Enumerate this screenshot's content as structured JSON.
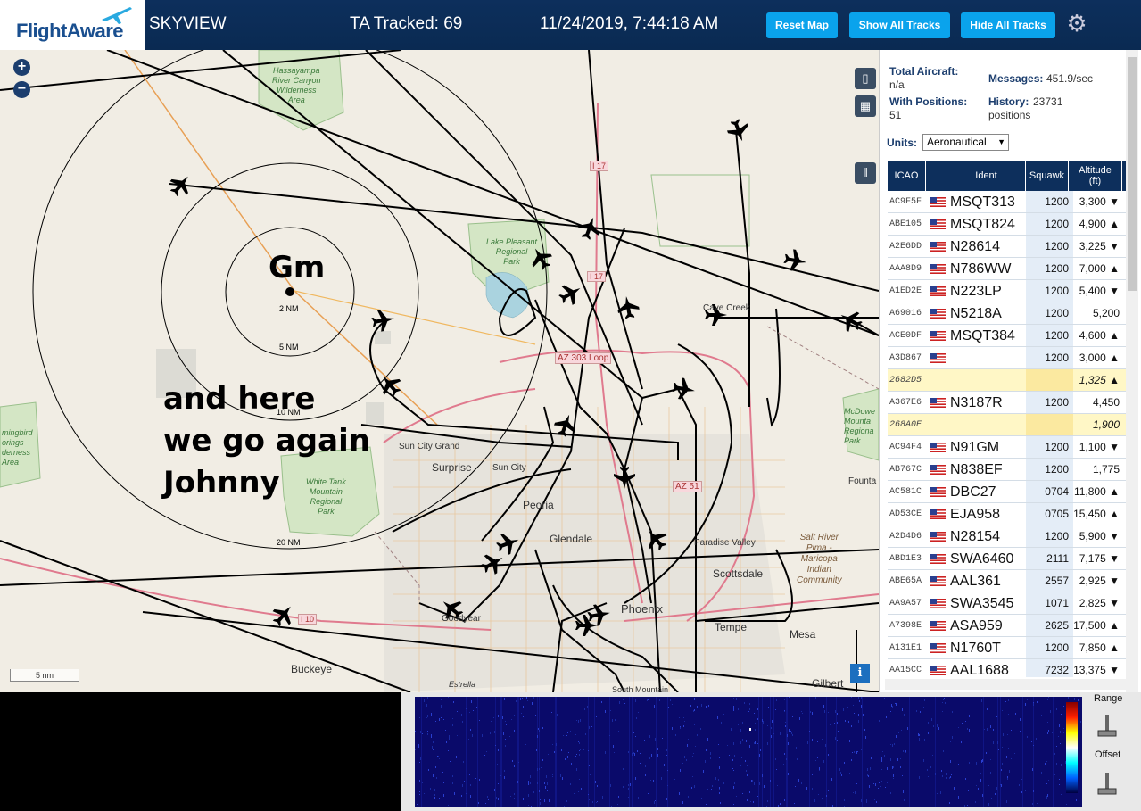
{
  "app": {
    "logo_text": "FlightAware",
    "title": "SKYVIEW",
    "tracked": "TA Tracked: 69",
    "datetime": "11/24/2019, 7:44:18 AM"
  },
  "toolbar": {
    "reset_map": "Reset Map",
    "show_all_tracks": "Show All Tracks",
    "hide_all_tracks": "Hide All Tracks",
    "settings_icon": "gear-icon"
  },
  "map": {
    "zoom_in": "+",
    "zoom_out": "−",
    "scale": "5 nm",
    "info_icon": "i",
    "overlay_text_1": "Gm",
    "overlay_text_2a": "and here",
    "overlay_text_2b": "we go again",
    "overlay_text_2c": "Johnny",
    "range_rings": [
      "2 NM",
      "5 NM",
      "10 NM",
      "20 NM"
    ],
    "places": {
      "hassayampa": [
        "Hassayampa",
        "River Canyon",
        "Wilderness",
        "Area"
      ],
      "lake_pleasant": [
        "Lake Pleasant",
        "Regional",
        "Park"
      ],
      "white_tank": [
        "White Tank",
        "Mountain",
        "Regional",
        "Park"
      ],
      "mcdowell": [
        "McDowe",
        "Mounta",
        "Regiona",
        "Park"
      ],
      "hummingbird": [
        "mingbird",
        "orings",
        "derness",
        "Area"
      ],
      "salt_river": [
        "Salt River",
        "Pima -",
        "Maricopa",
        "Indian",
        "Community"
      ],
      "cave_creek": "Cave Creek",
      "sun_city_grand": "Sun City Grand",
      "surprise": "Surprise",
      "sun_city": "Sun City",
      "peoria": "Peoria",
      "glendale": "Glendale",
      "paradise_valley": "Paradise Valley",
      "scottsdale": "Scottsdale",
      "phoenix": "Phoenix",
      "tempe": "Tempe",
      "mesa": "Mesa",
      "goodyear": "Goodyear",
      "buckeye": "Buckeye",
      "gilbert": "Gilbert",
      "estrella": "Estrella",
      "south_mountain": "South Mountain",
      "fountain": "Founta",
      "i17": "I 17",
      "i17b": "I 17",
      "az303": "AZ 303 Loop",
      "az51": "AZ 51",
      "i10": "I 10"
    }
  },
  "stats": {
    "total_aircraft_label": "Total Aircraft:",
    "total_aircraft": "n/a",
    "with_positions_label": "With Positions:",
    "with_positions": "51",
    "messages_label": "Messages:",
    "messages": "451.9/sec",
    "history_label": "History:",
    "history": "23731",
    "history_unit": "positions"
  },
  "units": {
    "label": "Units:",
    "value": "Aeronautical"
  },
  "table": {
    "headers": [
      "ICAO",
      "",
      "Ident",
      "Squawk",
      "Altitude",
      "(ft)"
    ],
    "rows": [
      {
        "icao": "AC9F5F",
        "flag": true,
        "ident": "MSQT313",
        "squawk": "1200",
        "alt": "3,300 ▼",
        "hl": false
      },
      {
        "icao": "ABE105",
        "flag": true,
        "ident": "MSQT824",
        "squawk": "1200",
        "alt": "4,900 ▲",
        "hl": false
      },
      {
        "icao": "A2E6DD",
        "flag": true,
        "ident": "N28614",
        "squawk": "1200",
        "alt": "3,225 ▼",
        "hl": false
      },
      {
        "icao": "AAA8D9",
        "flag": true,
        "ident": "N786WW",
        "squawk": "1200",
        "alt": "7,000 ▲",
        "hl": false
      },
      {
        "icao": "A1ED2E",
        "flag": true,
        "ident": "N223LP",
        "squawk": "1200",
        "alt": "5,400 ▼",
        "hl": false
      },
      {
        "icao": "A69016",
        "flag": true,
        "ident": "N5218A",
        "squawk": "1200",
        "alt": "5,200",
        "hl": false
      },
      {
        "icao": "ACE0DF",
        "flag": true,
        "ident": "MSQT384",
        "squawk": "1200",
        "alt": "4,600 ▲",
        "hl": false
      },
      {
        "icao": "A3D867",
        "flag": true,
        "ident": "",
        "squawk": "1200",
        "alt": "3,000 ▲",
        "hl": false
      },
      {
        "icao": "2682D5",
        "flag": false,
        "ident": "",
        "squawk": "",
        "alt": "1,325 ▲",
        "hl": true
      },
      {
        "icao": "A367E6",
        "flag": true,
        "ident": "N3187R",
        "squawk": "1200",
        "alt": "4,450",
        "hl": false
      },
      {
        "icao": "268A0E",
        "flag": false,
        "ident": "",
        "squawk": "",
        "alt": "1,900",
        "hl": true
      },
      {
        "icao": "AC94F4",
        "flag": true,
        "ident": "N91GM",
        "squawk": "1200",
        "alt": "1,100 ▼",
        "hl": false
      },
      {
        "icao": "AB767C",
        "flag": true,
        "ident": "N838EF",
        "squawk": "1200",
        "alt": "1,775",
        "hl": false
      },
      {
        "icao": "AC581C",
        "flag": true,
        "ident": "DBC27",
        "squawk": "0704",
        "alt": "11,800 ▲",
        "hl": false
      },
      {
        "icao": "AD53CE",
        "flag": true,
        "ident": "EJA958",
        "squawk": "0705",
        "alt": "15,450 ▲",
        "hl": false
      },
      {
        "icao": "A2D4D6",
        "flag": true,
        "ident": "N28154",
        "squawk": "1200",
        "alt": "5,900 ▼",
        "hl": false
      },
      {
        "icao": "ABD1E3",
        "flag": true,
        "ident": "SWA6460",
        "squawk": "2111",
        "alt": "7,175 ▼",
        "hl": false
      },
      {
        "icao": "ABE65A",
        "flag": true,
        "ident": "AAL361",
        "squawk": "2557",
        "alt": "2,925 ▼",
        "hl": false
      },
      {
        "icao": "AA9A57",
        "flag": true,
        "ident": "SWA3545",
        "squawk": "1071",
        "alt": "2,825 ▼",
        "hl": false
      },
      {
        "icao": "A7398E",
        "flag": true,
        "ident": "ASA959",
        "squawk": "2625",
        "alt": "17,500 ▲",
        "hl": false
      },
      {
        "icao": "A131E1",
        "flag": true,
        "ident": "N1760T",
        "squawk": "1200",
        "alt": "7,850 ▲",
        "hl": false
      },
      {
        "icao": "AA15CC",
        "flag": true,
        "ident": "AAL1688",
        "squawk": "7232",
        "alt": "13,375 ▼",
        "hl": false
      }
    ]
  },
  "spectrum": {
    "range_label": "Range",
    "offset_label": "Offset"
  },
  "colors": {
    "topbar": "#0d2f5c",
    "button": "#0aa3ec",
    "highlight_row": "#fff7c6"
  }
}
